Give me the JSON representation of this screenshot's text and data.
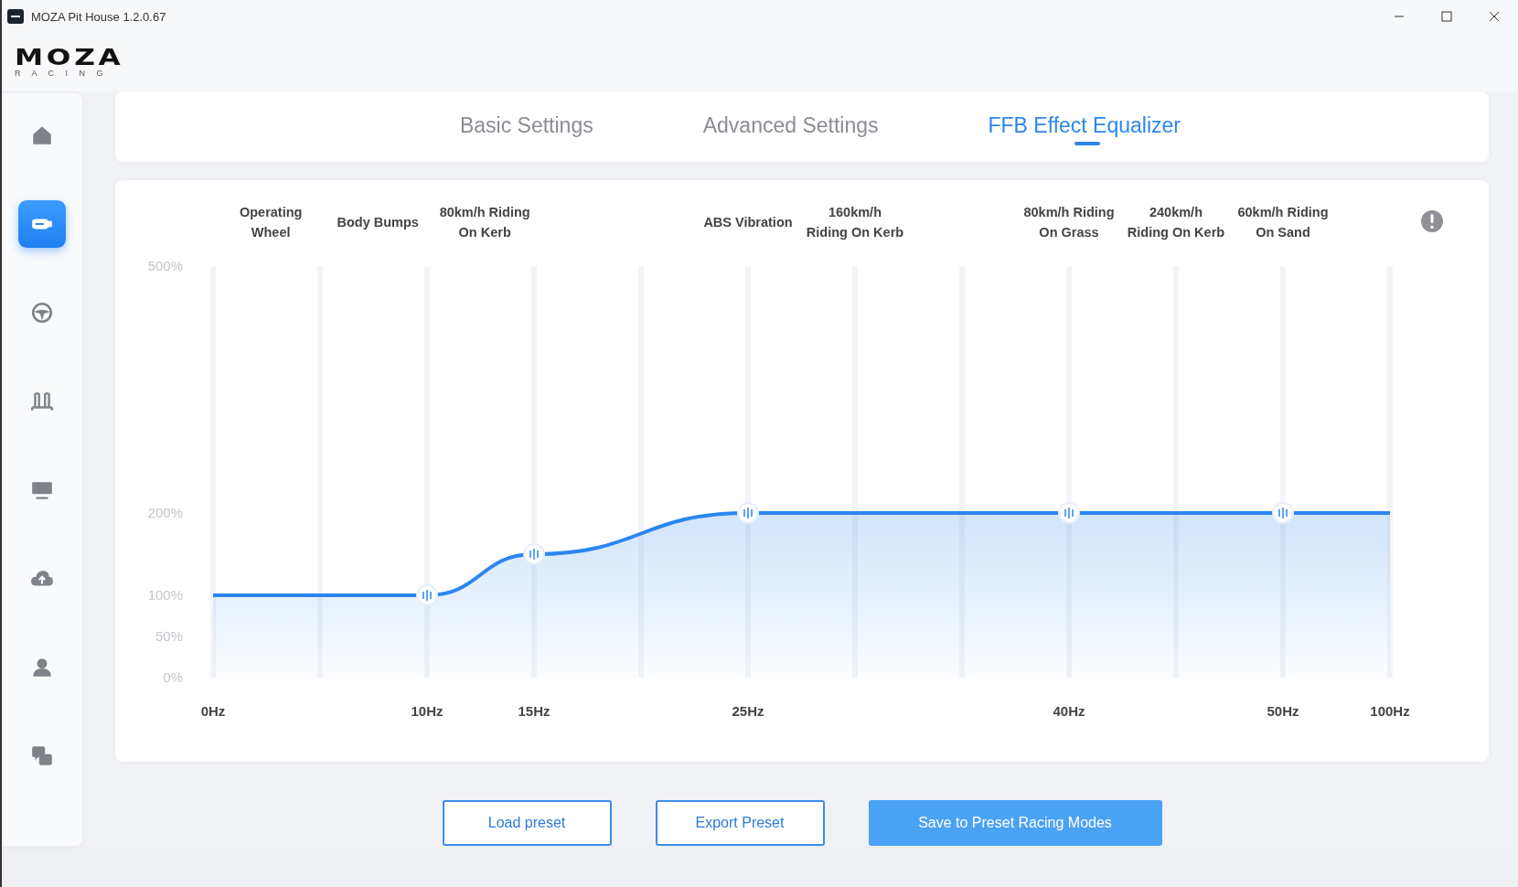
{
  "window": {
    "title": "MOZA Pit House 1.2.0.67"
  },
  "logo": {
    "wordmark": "MOZA",
    "tagline": "R A C I N G"
  },
  "sidebar": {
    "items": [
      {
        "kind": "home",
        "selected": false
      },
      {
        "kind": "wheelbase",
        "selected": true
      },
      {
        "kind": "steering",
        "selected": false
      },
      {
        "kind": "pedals",
        "selected": false
      },
      {
        "kind": "display",
        "selected": false
      },
      {
        "kind": "cloud",
        "selected": false
      },
      {
        "kind": "account",
        "selected": false
      },
      {
        "kind": "help",
        "selected": false
      }
    ]
  },
  "tabs": [
    {
      "label": "Basic Settings",
      "selected": false
    },
    {
      "label": "Advanced Settings",
      "selected": false
    },
    {
      "label": "FFB Effect Equalizer",
      "selected": true
    }
  ],
  "equalizer": {
    "bands": [
      "Operating\nWheel",
      "Body Bumps",
      "80km/h Riding\nOn Kerb",
      "ABS Vibration",
      "160km/h\nRiding On Kerb",
      "80km/h Riding\nOn Grass",
      "240km/h\nRiding On Kerb",
      "60km/h Riding\nOn Sand"
    ],
    "chart_data": {
      "type": "area",
      "categories": [
        "0Hz",
        "10Hz",
        "15Hz",
        "25Hz",
        "40Hz",
        "50Hz",
        "100Hz"
      ],
      "grid": true,
      "series": [
        {
          "color": "#2b86f0",
          "values": [
            100,
            100,
            150,
            200,
            200,
            200,
            200
          ]
        }
      ],
      "ylim": [
        0,
        500
      ],
      "yticks": [
        {
          "value": 0,
          "label": "0%"
        },
        {
          "value": 50,
          "label": "50%"
        },
        {
          "value": 100,
          "label": "100%"
        },
        {
          "value": 200,
          "label": "200%"
        },
        {
          "value": 500,
          "label": "500%"
        }
      ]
    }
  },
  "buttons": [
    {
      "label": "Load preset",
      "kind": "outline"
    },
    {
      "label": "Export Preset",
      "kind": "outline"
    },
    {
      "label": "Save to Preset Racing Modes",
      "kind": "primary"
    }
  ]
}
